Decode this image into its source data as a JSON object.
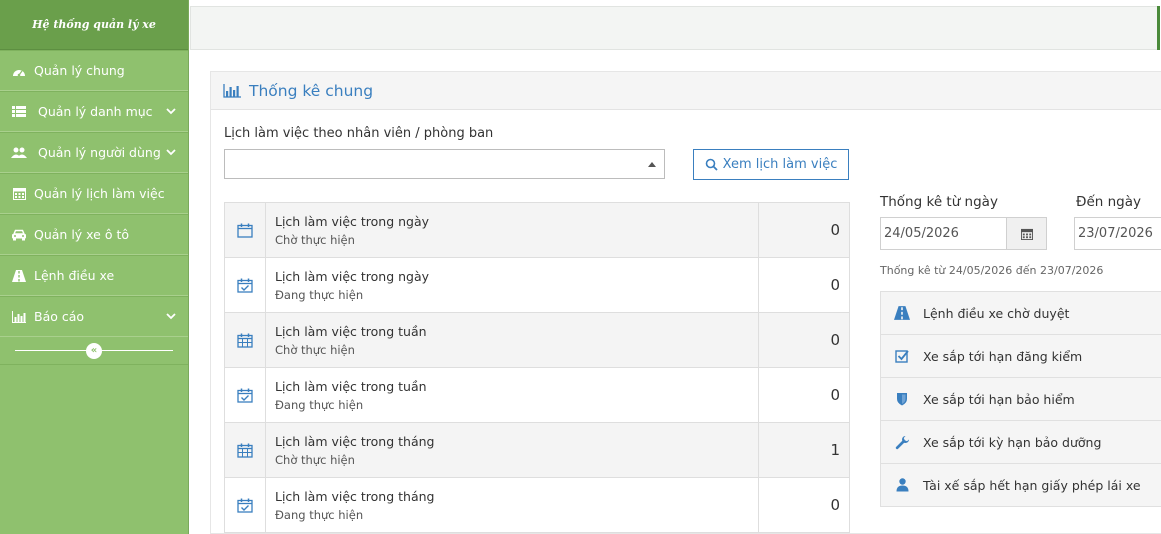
{
  "sidebar": {
    "brand": "Hệ thống quản lý xe",
    "items": [
      {
        "label": "Quản lý chung"
      },
      {
        "label": "Quản lý danh mục"
      },
      {
        "label": "Quản lý người dùng"
      },
      {
        "label": "Quản lý lịch làm việc"
      },
      {
        "label": "Quản lý xe ô tô"
      },
      {
        "label": "Lệnh điều xe"
      },
      {
        "label": "Báo cáo"
      }
    ],
    "collapse_glyph": "«"
  },
  "panel": {
    "title": "Thống kê chung",
    "schedule_label": "Lịch làm việc theo nhân viên / phòng ban",
    "select_value": "",
    "view_button": "Xem lịch làm việc"
  },
  "schedule": [
    {
      "title": "Lịch làm việc trong ngày",
      "status": "Chờ thực hiện",
      "count": "0",
      "icon": "calendar-icon"
    },
    {
      "title": "Lịch làm việc trong ngày",
      "status": "Đang thực hiện",
      "count": "0",
      "icon": "calendar-check-icon"
    },
    {
      "title": "Lịch làm việc trong tuần",
      "status": "Chờ thực hiện",
      "count": "0",
      "icon": "calendar-grid-icon"
    },
    {
      "title": "Lịch làm việc trong tuần",
      "status": "Đang thực hiện",
      "count": "0",
      "icon": "calendar-check-icon"
    },
    {
      "title": "Lịch làm việc trong tháng",
      "status": "Chờ thực hiện",
      "count": "1",
      "icon": "calendar-grid-icon"
    },
    {
      "title": "Lịch làm việc trong tháng",
      "status": "Đang thực hiện",
      "count": "0",
      "icon": "calendar-check-icon"
    }
  ],
  "filter": {
    "from_label": "Thống kê từ ngày",
    "to_label": "Đến ngày",
    "from_date": "24/05/2026",
    "to_date": "23/07/2026",
    "range_text": "Thống kê từ 24/05/2026 đến 23/07/2026"
  },
  "stats": [
    {
      "label": "Lệnh điều xe chờ duyệt",
      "icon": "road-icon"
    },
    {
      "label": "Xe sắp tới hạn đăng kiểm",
      "icon": "check-square-icon"
    },
    {
      "label": "Xe sắp tới hạn bảo hiểm",
      "icon": "shield-icon"
    },
    {
      "label": "Xe sắp tới kỳ hạn bảo dưỡng",
      "icon": "wrench-icon"
    },
    {
      "label": "Tài xế sắp hết hạn giấy phép lái xe",
      "icon": "user-icon"
    }
  ],
  "colors": {
    "sidebar": "#8fc16e",
    "accent": "#3a7fbf"
  }
}
